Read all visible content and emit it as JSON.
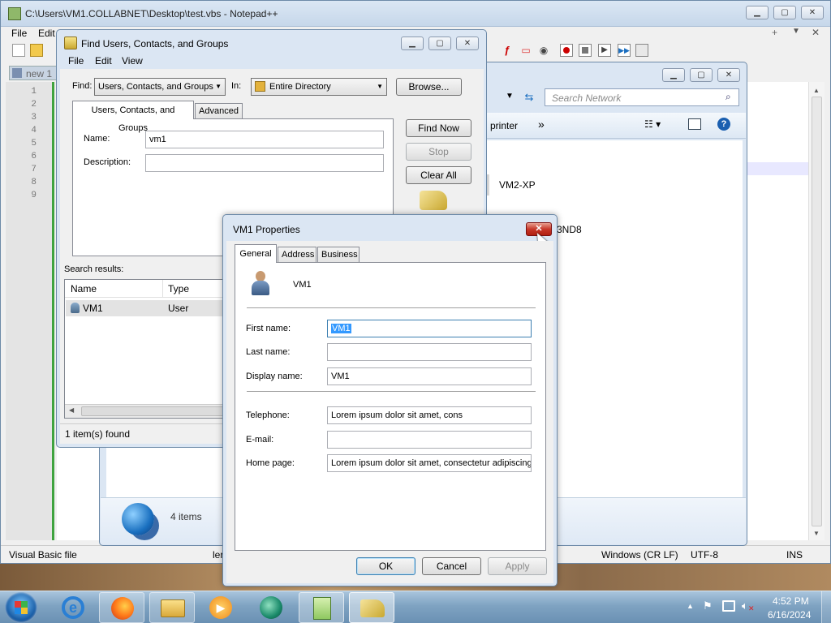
{
  "notepad": {
    "title": "C:\\Users\\VM1.COLLABNET\\Desktop\\test.vbs - Notepad++",
    "menu": [
      "File",
      "Edit"
    ],
    "tab_label": "new 1",
    "line_numbers": [
      "1",
      "2",
      "3",
      "4",
      "5",
      "6",
      "7",
      "8",
      "9"
    ],
    "status": {
      "file_type": "Visual Basic file",
      "length_partial": "ler",
      "eol": "Windows (CR LF)",
      "encoding": "UTF-8",
      "mode": "INS"
    },
    "right_controls": [
      "+",
      "▼",
      "✕"
    ]
  },
  "network": {
    "search_placeholder": "Search Network",
    "toolbar_item": "printer",
    "more": "»",
    "items": [
      {
        "label": "VM2-XP"
      },
      {
        "label": "3ND8"
      }
    ],
    "footer_count": "4 items"
  },
  "find": {
    "title": "Find Users, Contacts, and Groups",
    "menu": [
      "File",
      "Edit",
      "View"
    ],
    "find_label": "Find:",
    "find_value": "Users, Contacts, and Groups",
    "in_label": "In:",
    "in_value": "Entire Directory",
    "browse": "Browse...",
    "tabs": [
      "Users, Contacts, and Groups",
      "Advanced"
    ],
    "name_label": "Name:",
    "name_value": "vm1",
    "description_label": "Description:",
    "description_value": "",
    "find_now": "Find Now",
    "stop": "Stop",
    "clear_all": "Clear All",
    "results_label": "Search results:",
    "columns": [
      "Name",
      "Type"
    ],
    "rows": [
      {
        "name": "VM1",
        "type": "User"
      }
    ],
    "status": "1 item(s) found"
  },
  "props": {
    "title": "VM1 Properties",
    "tabs": [
      "General",
      "Address",
      "Business"
    ],
    "user_name": "VM1",
    "first_name_label": "First name:",
    "first_name_value": "VM1",
    "last_name_label": "Last name:",
    "last_name_value": "",
    "display_name_label": "Display name:",
    "display_name_value": "VM1",
    "telephone_label": "Telephone:",
    "telephone_value": "Lorem ipsum dolor sit amet, cons",
    "email_label": "E-mail:",
    "email_value": "",
    "homepage_label": "Home page:",
    "homepage_value": "Lorem ipsum dolor sit amet, consectetur adipiscing el",
    "ok": "OK",
    "cancel": "Cancel",
    "apply": "Apply"
  },
  "taskbar": {
    "time": "4:52 PM",
    "date": "6/16/2024",
    "apps": [
      "internet-explorer",
      "firefox",
      "file-explorer",
      "media-player",
      "app",
      "notepad-plus-plus",
      "find-users"
    ]
  }
}
